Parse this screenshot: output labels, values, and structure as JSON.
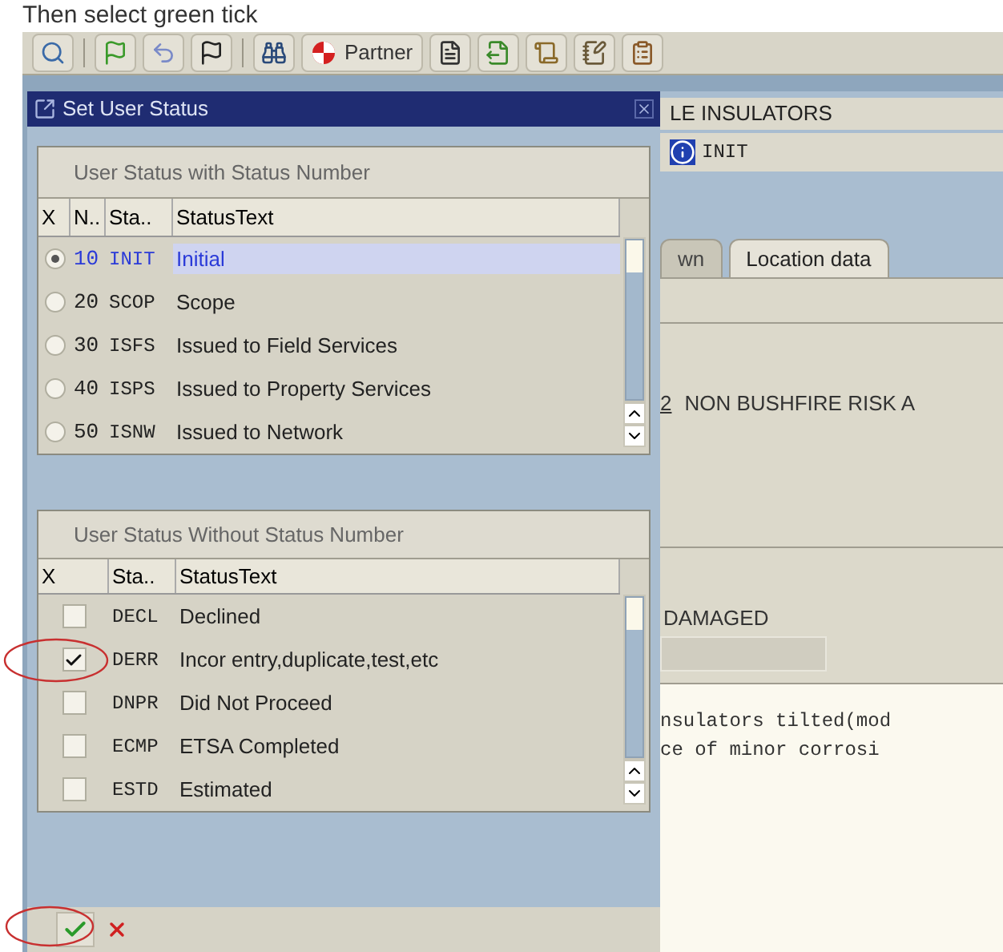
{
  "caption": "Then select green tick",
  "toolbar": {
    "partner_label": "Partner"
  },
  "dialog": {
    "title": "Set User Status",
    "numbered": {
      "title": "User Status with Status Number",
      "columns": [
        "X",
        "N..",
        "Sta..",
        "StatusText"
      ],
      "rows": [
        {
          "number": "10",
          "code": "INIT",
          "text": "Initial",
          "selected": true
        },
        {
          "number": "20",
          "code": "SCOP",
          "text": "Scope",
          "selected": false
        },
        {
          "number": "30",
          "code": "ISFS",
          "text": "Issued to Field Services",
          "selected": false
        },
        {
          "number": "40",
          "code": "ISPS",
          "text": "Issued to Property Services",
          "selected": false
        },
        {
          "number": "50",
          "code": "ISNW",
          "text": "Issued to Network",
          "selected": false
        }
      ]
    },
    "unnumbered": {
      "title": "User Status Without Status Number",
      "columns": [
        "X",
        "Sta..",
        "StatusText"
      ],
      "rows": [
        {
          "code": "DECL",
          "text": "Declined",
          "checked": false
        },
        {
          "code": "DERR",
          "text": "Incor entry,duplicate,test,etc",
          "checked": true
        },
        {
          "code": "DNPR",
          "text": "Did Not Proceed",
          "checked": false
        },
        {
          "code": "ECMP",
          "text": "ETSA Completed",
          "checked": false
        },
        {
          "code": "ESTD",
          "text": "Estimated",
          "checked": false
        }
      ]
    }
  },
  "background": {
    "object_title": "LE INSULATORS",
    "status": "INIT",
    "tabs": [
      {
        "label": "wn",
        "selected": false
      },
      {
        "label": "Location data",
        "selected": true
      }
    ],
    "area_code": "2",
    "area_text": "NON BUSHFIRE RISK A",
    "condition": "DAMAGED",
    "notes": [
      "nsulators tilted(mod",
      "ce of minor corrosi"
    ]
  }
}
